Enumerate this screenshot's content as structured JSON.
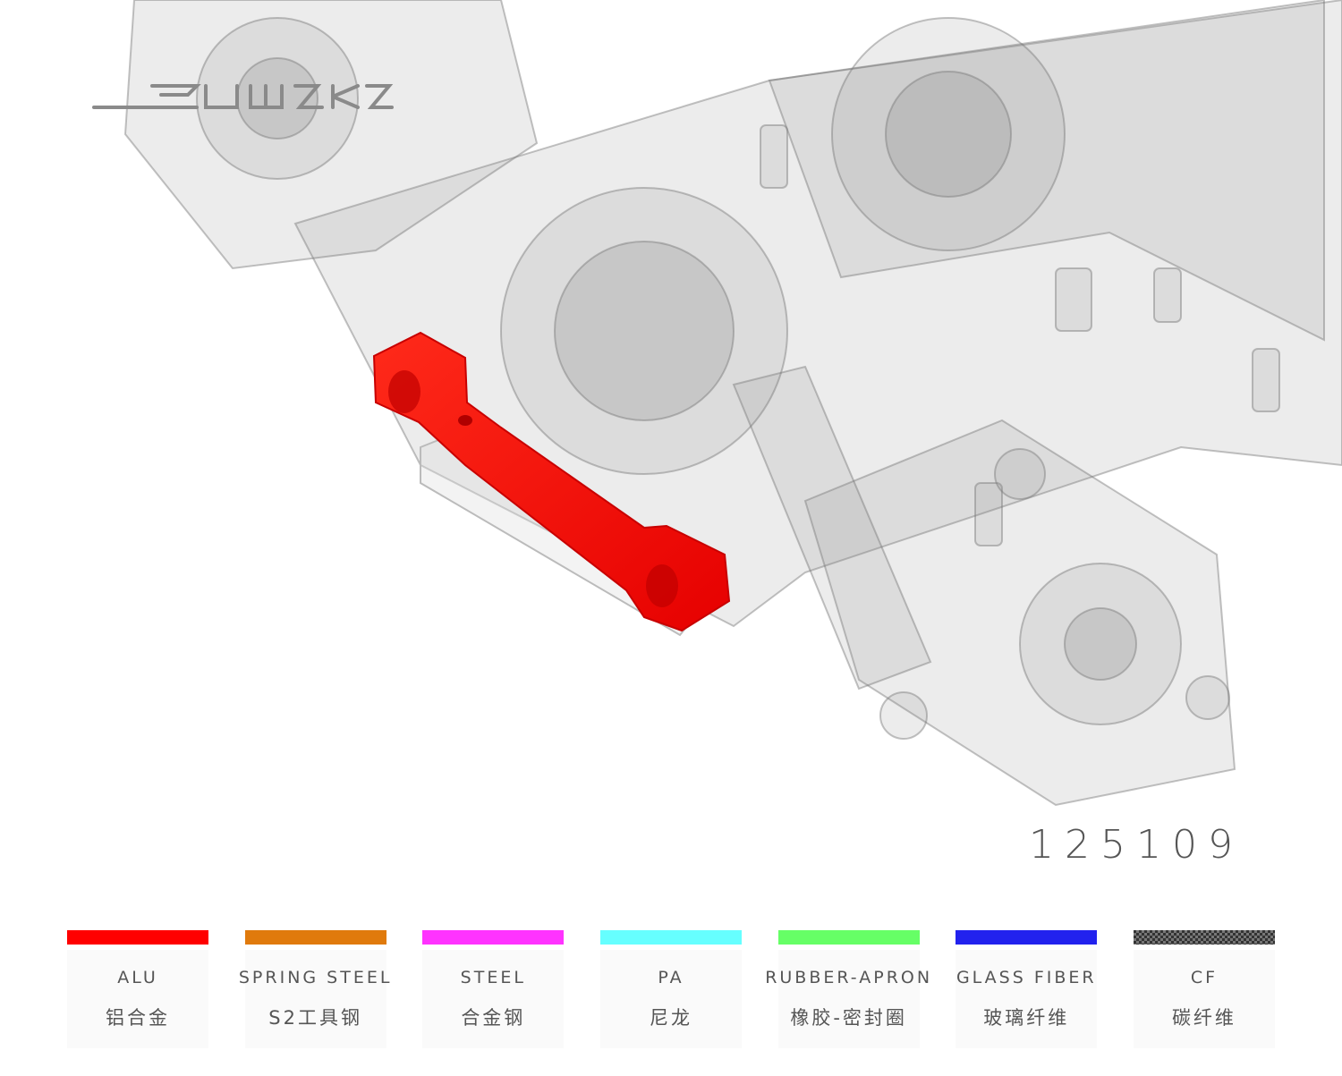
{
  "brand": {
    "logo_text": "SWORKZ"
  },
  "part_number": "125109",
  "highlight_part_color": "#ff0000",
  "materials": [
    {
      "label_en": "ALU",
      "label_zh": "铝合金",
      "color": "#ff0000"
    },
    {
      "label_en": "SPRING STEEL",
      "label_zh": "S2工具钢",
      "color": "#e07a0c"
    },
    {
      "label_en": "STEEL",
      "label_zh": "合金钢",
      "color": "#ff33ff"
    },
    {
      "label_en": "PA",
      "label_zh": "尼龙",
      "color": "#66ffff"
    },
    {
      "label_en": "RUBBER-APRON",
      "label_zh": "橡胶-密封圈",
      "color": "#66ff66"
    },
    {
      "label_en": "GLASS FIBER",
      "label_zh": "玻璃纤维",
      "color": "#2222ee"
    },
    {
      "label_en": "CF",
      "label_zh": "碳纤维",
      "color": "#333333",
      "pattern": "carbon-weave"
    }
  ]
}
